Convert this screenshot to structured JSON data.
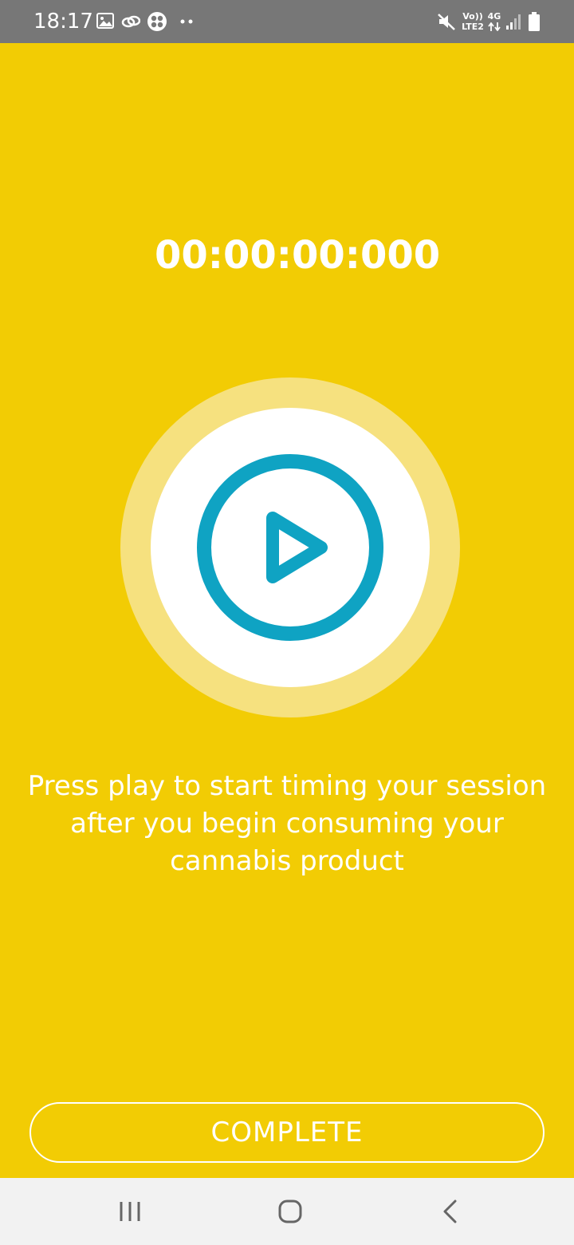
{
  "status_bar": {
    "time": "18:17",
    "icons": [
      "image-icon",
      "link-icon",
      "fan-icon",
      "more-dots-icon",
      "mute-icon",
      "volte-lte2-icon",
      "4g-data-icon",
      "signal-icon",
      "battery-icon"
    ],
    "volte_label": "Vo))",
    "lte_label": "LTE2",
    "network_label": "4G"
  },
  "timer": {
    "display": "00:00:00:000"
  },
  "play_button": {
    "icon": "play-icon",
    "accent_color": "#0fa3c3"
  },
  "instruction": {
    "text": "Press play to start timing your session after you begin consuming your cannabis product"
  },
  "actions": {
    "complete_label": "COMPLETE"
  },
  "nav_bar": {
    "items": [
      "recents-icon",
      "home-icon",
      "back-icon"
    ]
  },
  "colors": {
    "background": "#f2cc04",
    "status_bar": "#777777",
    "play_ring": "#f6e17f",
    "text": "#ffffff"
  }
}
